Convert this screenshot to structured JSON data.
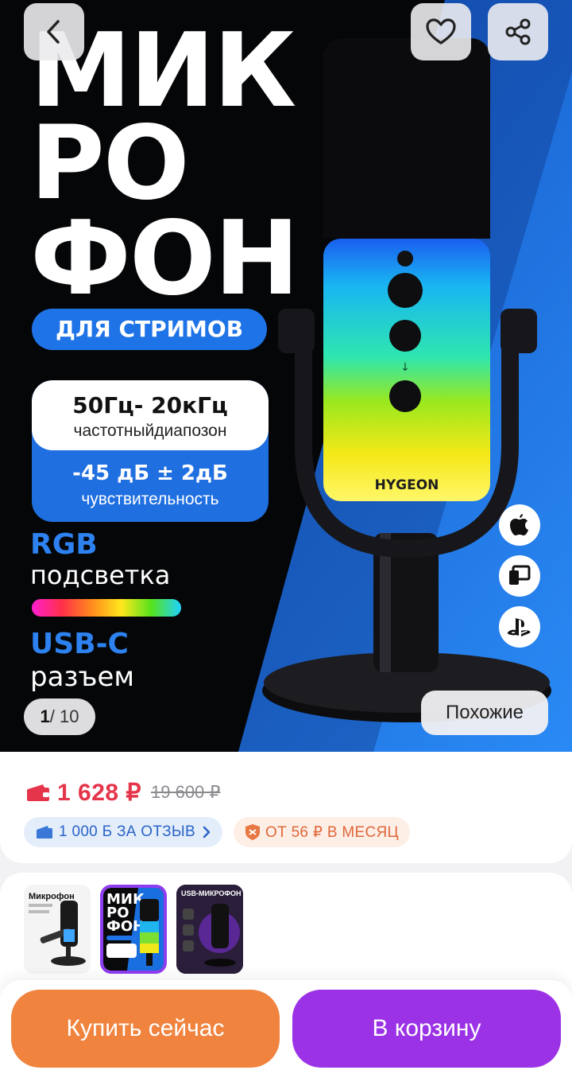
{
  "hero": {
    "title_lines": [
      "МИК",
      "РО",
      "ФОН"
    ],
    "tagline": "ДЛЯ СТРИМОВ",
    "spec_freq_value": "50Гц- 20кГц",
    "spec_freq_label": "частотныйдиапозон",
    "spec_sens_value": "-45 дБ ± 2дБ",
    "spec_sens_label": "чувствительность",
    "feature_rgb_title": "RGB",
    "feature_rgb_sub": "подсветка",
    "feature_usb_title": "USB-C",
    "feature_usb_sub": "разъем",
    "brand": "HYGEON",
    "counter_current": "1",
    "counter_total": "/ 10",
    "similar_label": "Похожие",
    "icons": [
      "chevron-left-icon",
      "heart-icon",
      "share-icon",
      "apple-icon",
      "pc-icon",
      "playstation-icon"
    ]
  },
  "price": {
    "current": "1 628 ₽",
    "old": "19 600 ₽",
    "review_bonus": "1 000 Б ЗА ОТЗЫВ",
    "installment": "ОТ 56 ₽ В МЕСЯЦ"
  },
  "thumbs": {
    "thumb1_title": "Микрофон",
    "thumb2_title_lines": [
      "МИК",
      "РО",
      "ФОН"
    ],
    "thumb3_title": "USB-МИКРОФОН",
    "selected_index": 2
  },
  "actions": {
    "buy_now": "Купить сейчас",
    "add_to_cart": "В корзину"
  },
  "colors": {
    "price_red": "#e5354a",
    "buy_orange": "#f0843f",
    "cart_purple": "#9b32e6",
    "hero_blue": "#1565d8"
  }
}
